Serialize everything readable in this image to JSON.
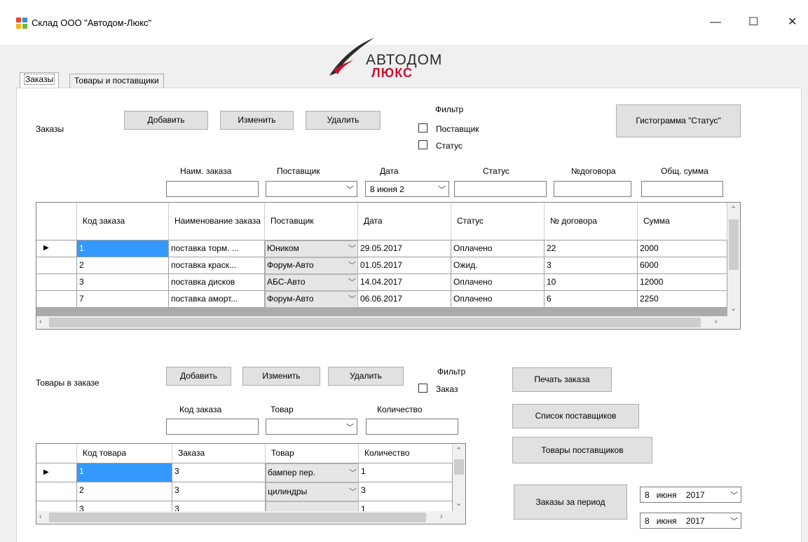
{
  "window": {
    "title": "Склад ООО \"Автодом-Люкс\"",
    "minimize": "—",
    "maximize": "☐",
    "close": "✕"
  },
  "logo": {
    "line1": "АВТОДОМ",
    "line2": "ЛЮКС"
  },
  "tabs": [
    {
      "label": "Заказы"
    },
    {
      "label": "Товары и поставщики"
    }
  ],
  "orders": {
    "section_label": "Заказы",
    "add": "Добавить",
    "edit": "Изменить",
    "delete": "Удалить",
    "filter": {
      "title": "Фильтр",
      "supplier": "Поставщик",
      "status": "Статус"
    },
    "histogram": "Гистограмма \"Статус\"",
    "fields": {
      "name_label": "Наим. заказа",
      "supplier_label": "Поставщик",
      "date_label": "Дата",
      "status_label": "Статус",
      "contract_label": "№договора",
      "sum_label": "Общ. сумма",
      "date_value": "8   июня   2"
    },
    "grid": {
      "columns": [
        "Код заказа",
        "Наименование заказа",
        "Поставщик",
        "Дата",
        "Статус",
        "№ договора",
        "Сумма"
      ],
      "rows": [
        [
          "1",
          "поставка торм. ...",
          "Юником",
          "29.05.2017",
          "Оплачено",
          "22",
          "2000"
        ],
        [
          "2",
          "поставка краск...",
          "Форум-Авто",
          "01.05.2017",
          "Ожид.",
          "3",
          "6000"
        ],
        [
          "3",
          "поставка дисков",
          "АБС-Авто",
          "14.04.2017",
          "Оплачено",
          "10",
          "12000"
        ],
        [
          "7",
          "поставка аморт...",
          "Форум-Авто",
          "06.06.2017",
          "Оплачено",
          "6",
          "2250"
        ]
      ]
    }
  },
  "items": {
    "section_label": "Товары в заказе",
    "add": "Добавить",
    "edit": "Изменить",
    "delete": "Удалить",
    "filter": {
      "title": "Фильтр",
      "order": "Заказ"
    },
    "fields": {
      "order_code_label": "Код заказа",
      "product_label": "Товар",
      "qty_label": "Количество"
    },
    "grid": {
      "columns": [
        "Код товара",
        "Заказа",
        "Товар",
        "Количество"
      ],
      "rows": [
        [
          "1",
          "3",
          "бампер пер.",
          "1"
        ],
        [
          "2",
          "3",
          "цилиндры",
          "3"
        ],
        [
          "3",
          "3",
          "",
          "1"
        ]
      ]
    }
  },
  "actions": {
    "print_order": "Печать заказа",
    "supplier_list": "Список поставщиков",
    "supplier_products": "Товары поставщиков",
    "orders_period": "Заказы за период"
  },
  "period": {
    "from": {
      "day": "8",
      "month": "июня",
      "year": "2017"
    },
    "to": {
      "day": "8",
      "month": "июня",
      "year": "2017"
    }
  },
  "colors": {
    "selection": "#3399ff",
    "logo_red": "#c8102e",
    "logo_dark": "#2b2b2b"
  }
}
